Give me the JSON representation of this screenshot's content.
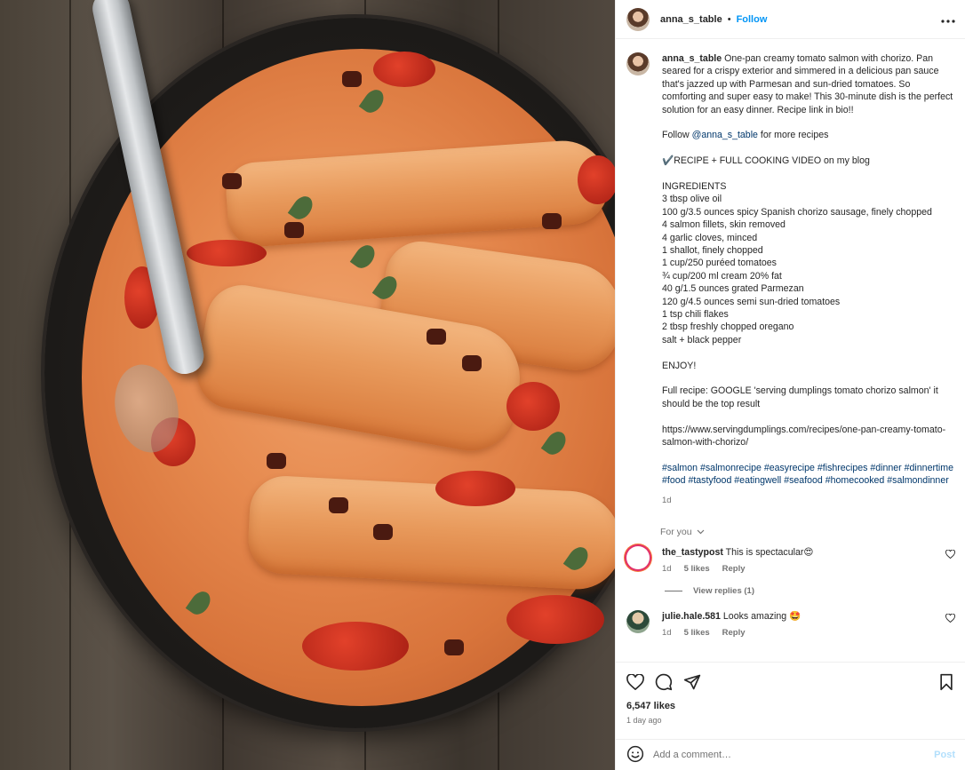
{
  "post": {
    "username": "anna_s_table",
    "follow_label": "Follow",
    "separator": "•",
    "more_label": "•••"
  },
  "caption": {
    "username": "anna_s_table",
    "lines": [
      "One-pan creamy tomato salmon with chorizo. Pan seared for a crispy exterior and simmered in a delicious pan sauce that's jazzed up with Parmesan and sun-dried tomatoes. So comforting and super easy to make! This 30-minute dish is the perfect solution for an easy dinner. Recipe link in bio!!"
    ],
    "follow_prefix": "Follow ",
    "follow_mention": "@anna_s_table",
    "follow_suffix": " for more recipes",
    "recipe_line": "✔️RECIPE + FULL COOKING VIDEO on my blog",
    "ingredients_title": "INGREDIENTS",
    "ingredients": [
      "3 tbsp olive oil",
      "100 g/3.5 ounces spicy Spanish chorizo sausage, finely chopped",
      "4 salmon fillets, skin removed",
      "4 garlic cloves, minced",
      "1 shallot, finely chopped",
      "1 cup/250 puréed tomatoes",
      "¾ cup/200 ml cream 20% fat",
      "40 g/1.5 ounces grated Parmezan",
      "120 g/4.5 ounces semi sun-dried tomatoes",
      "1 tsp chili flakes",
      "2 tbsp freshly chopped oregano",
      "salt + black pepper"
    ],
    "enjoy": "ENJOY!",
    "full_recipe": "Full recipe: GOOGLE 'serving dumplings tomato chorizo salmon' it should be the top result",
    "url": "https://www.servingdumplings.com/recipes/one-pan-creamy-tomato-salmon-with-chorizo/",
    "hashtags": "#salmon #salmonrecipe #easyrecipe #fishrecipes #dinner #dinnertime #food #tastyfood #eatingwell #seafood #homecooked #salmondinner",
    "time": "1d"
  },
  "for_you_label": "For you",
  "comments": [
    {
      "username": "the_tastypost",
      "text": "This is spectacular😍",
      "time": "1d",
      "likes": "5 likes",
      "reply": "Reply",
      "view_replies": "View replies (1)"
    },
    {
      "username": "julie.hale.581",
      "text": "Looks amazing 🤩",
      "time": "1d",
      "likes": "5 likes",
      "reply": "Reply"
    }
  ],
  "stats": {
    "likes": "6,547 likes",
    "ago": "1 day ago"
  },
  "add_comment": {
    "placeholder": "Add a comment…",
    "post_label": "Post"
  },
  "colors": {
    "link_blue": "#0095f6",
    "hashtag_blue": "#00376b",
    "muted": "#737373",
    "post_disabled": "#b2dffc"
  },
  "icons": [
    "more-icon",
    "heart-icon",
    "comment-icon",
    "share-icon",
    "bookmark-icon",
    "emoji-icon",
    "chevron-down-icon"
  ]
}
